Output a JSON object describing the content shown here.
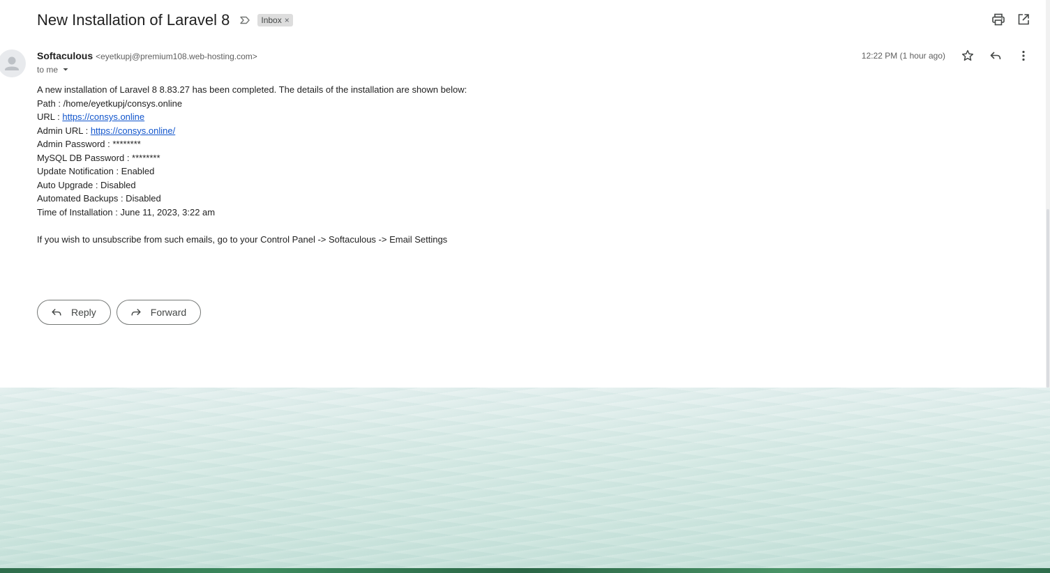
{
  "email": {
    "subject": "New Installation of Laravel 8",
    "label": "Inbox",
    "label_remove": "×",
    "sender_name": "Softaculous",
    "sender_email": "<eyetkupj@premium108.web-hosting.com>",
    "recipient": "to me",
    "timestamp": "12:22 PM (1 hour ago)",
    "body": {
      "intro": "A new installation of Laravel 8 8.83.27 has been completed. The details of the installation are shown below:",
      "path": "Path : /home/eyetkupj/consys.online",
      "url_label": "URL : ",
      "url": "https://consys.online",
      "admin_url_label": "Admin URL : ",
      "admin_url": "https://consys.online/",
      "admin_password": "Admin Password : ********",
      "mysql_password": "MySQL DB Password : ********",
      "update_notification": "Update Notification : Enabled",
      "auto_upgrade": "Auto Upgrade : Disabled",
      "automated_backups": "Automated Backups : Disabled",
      "install_time": "Time of Installation : June 11, 2023, 3:22 am",
      "unsubscribe": "If you wish to unsubscribe from such emails, go to your Control Panel -> Softaculous -> Email Settings"
    }
  },
  "actions": {
    "reply_label": "Reply",
    "forward_label": "Forward"
  },
  "icons": {
    "importance": "importance-marker-icon",
    "print": "print-icon",
    "open_new_window": "open-in-new-window-icon",
    "star": "star-icon",
    "reply": "reply-icon",
    "more": "more-vert-icon",
    "avatar": "person-avatar-icon",
    "dropdown": "caret-down-icon",
    "forward": "forward-icon"
  },
  "colors": {
    "link": "#1155cc",
    "chip_bg": "#dddddd",
    "text": "#202124",
    "muted": "#5e5e5e"
  }
}
